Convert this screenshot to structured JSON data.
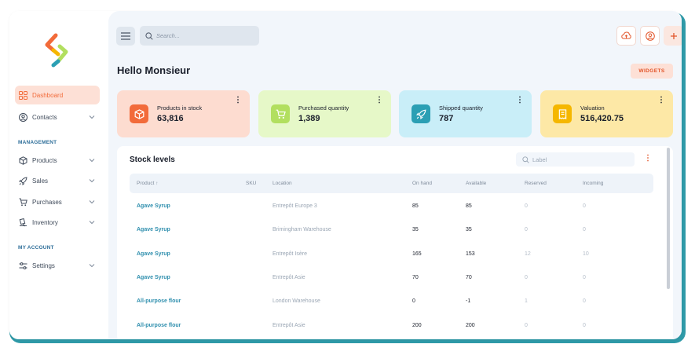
{
  "sidebar": {
    "items": [
      {
        "label": "Dashboard",
        "icon": "grid-icon",
        "active": true
      },
      {
        "label": "Contacts",
        "icon": "user-circle-icon"
      },
      {
        "label": "Products",
        "icon": "box-icon"
      },
      {
        "label": "Sales",
        "icon": "rocket-icon"
      },
      {
        "label": "Purchases",
        "icon": "cart-icon"
      },
      {
        "label": "Inventory",
        "icon": "inventory-icon"
      },
      {
        "label": "Settings",
        "icon": "sliders-icon"
      }
    ],
    "sections": {
      "management": "MANAGEMENT",
      "my_account": "MY ACCOUNT"
    }
  },
  "header": {
    "search_placeholder": "Search...",
    "greeting": "Hello Monsieur",
    "widgets_label": "WIDGETS"
  },
  "cards": [
    {
      "label": "Products in stock",
      "value": "63,816",
      "icon": "box-icon",
      "bg": "#fddcd0",
      "icon_bg": "#f26b3a"
    },
    {
      "label": "Purchased quantity",
      "value": "1,389",
      "icon": "cart-icon",
      "bg": "#e6f8c8",
      "icon_bg": "#b2df5f"
    },
    {
      "label": "Shipped quantity",
      "value": "787",
      "icon": "rocket-icon",
      "bg": "#c9eef8",
      "icon_bg": "#2b9fb4"
    },
    {
      "label": "Valuation",
      "value": "516,420.75",
      "icon": "receipt-icon",
      "bg": "#fde8a6",
      "icon_bg": "#f5b700"
    }
  ],
  "stock": {
    "title": "Stock levels",
    "filter_placeholder": "Label",
    "columns": {
      "product": "Product ↑",
      "sku": "SKU",
      "location": "Location",
      "on_hand": "On hand",
      "available": "Available",
      "reserved": "Reserved",
      "incoming": "Incoming"
    },
    "rows": [
      {
        "product": "Agave Syrup",
        "sku": "",
        "location": "Entrepôt Europe 3",
        "on_hand": "85",
        "available": "85",
        "reserved": "0",
        "incoming": "0"
      },
      {
        "product": "Agave Syrup",
        "sku": "",
        "location": "Brimingham Warehouse",
        "on_hand": "35",
        "available": "35",
        "reserved": "0",
        "incoming": "0"
      },
      {
        "product": "Agave Syrup",
        "sku": "",
        "location": "Entrepôt Isère",
        "on_hand": "165",
        "available": "153",
        "reserved": "12",
        "incoming": "10"
      },
      {
        "product": "Agave Syrup",
        "sku": "",
        "location": "Entrepôt Asie",
        "on_hand": "70",
        "available": "70",
        "reserved": "0",
        "incoming": "0"
      },
      {
        "product": "All-purpose flour",
        "sku": "",
        "location": "London Warehouse",
        "on_hand": "0",
        "available": "-1",
        "reserved": "1",
        "incoming": "0"
      },
      {
        "product": "All-purpose flour",
        "sku": "",
        "location": "Entrepôt Asie",
        "on_hand": "200",
        "available": "200",
        "reserved": "0",
        "incoming": "0"
      }
    ]
  },
  "colors": {
    "accent": "#f26b3a",
    "teal": "#2f9aa8",
    "link": "#2f8fae"
  }
}
